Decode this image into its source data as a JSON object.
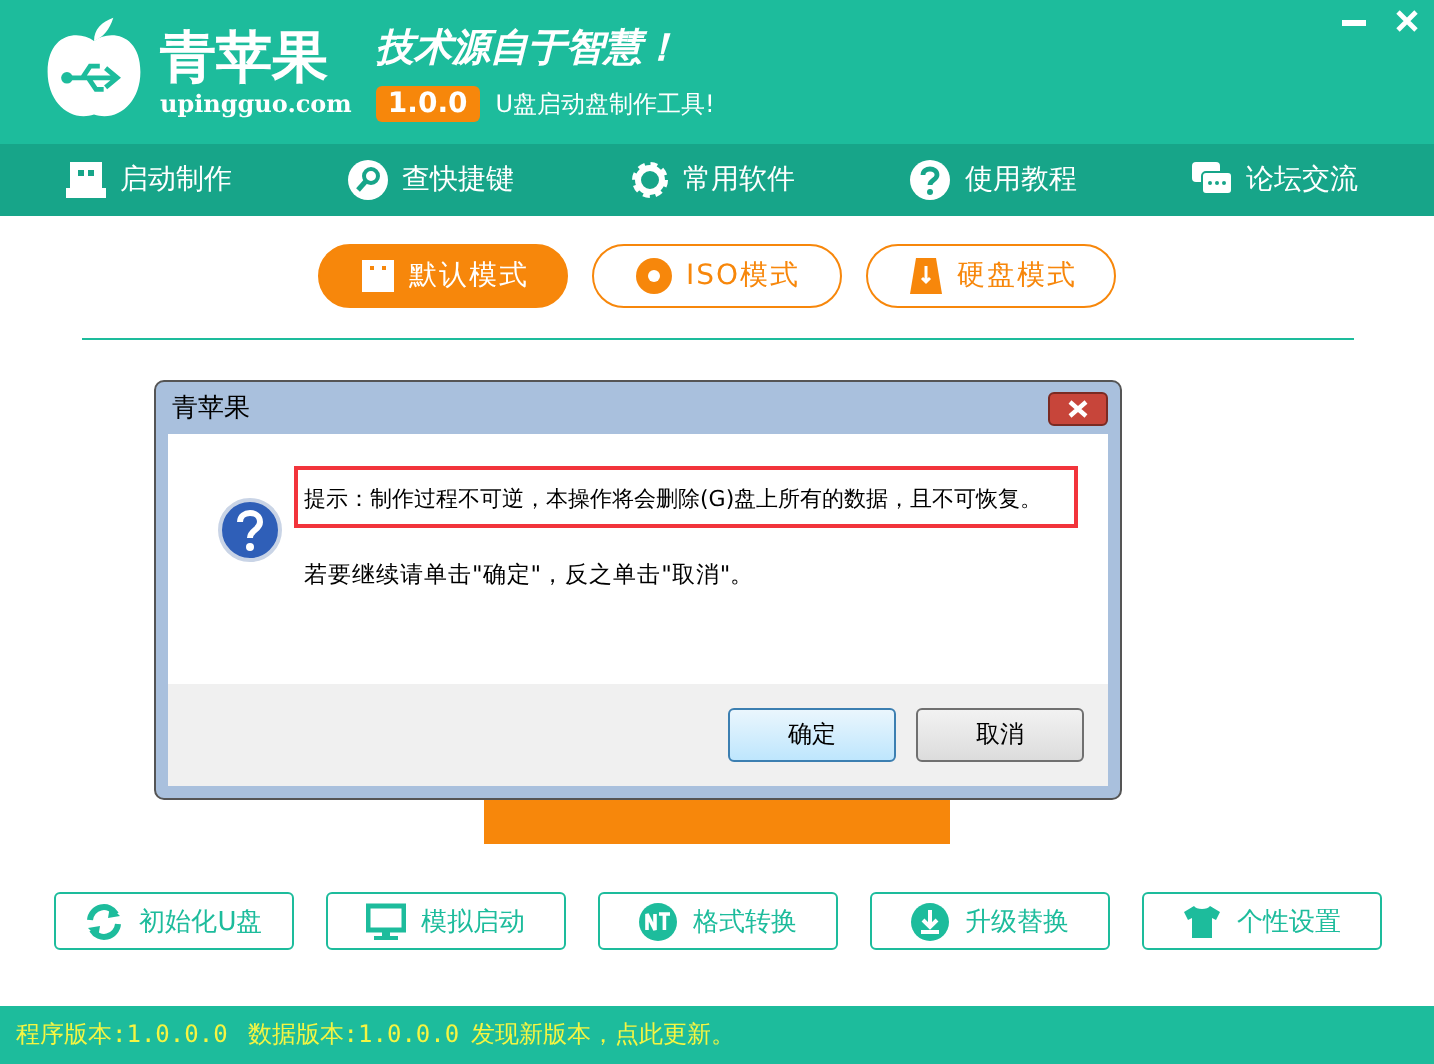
{
  "header": {
    "logo_text": "青苹果",
    "domain": "upingguo.com",
    "slogan": "技术源自于智慧！",
    "version": "1.0.0",
    "tagline": "U盘启动盘制作工具!"
  },
  "nav": [
    {
      "label": "启动制作"
    },
    {
      "label": "查快捷键"
    },
    {
      "label": "常用软件"
    },
    {
      "label": "使用教程"
    },
    {
      "label": "论坛交流"
    }
  ],
  "modes": [
    {
      "label": "默认模式",
      "selected": true
    },
    {
      "label": "ISO模式",
      "selected": false
    },
    {
      "label": "硬盘模式",
      "selected": false
    }
  ],
  "tools": [
    {
      "label": "初始化U盘"
    },
    {
      "label": "模拟启动"
    },
    {
      "label": "格式转换"
    },
    {
      "label": "升级替换"
    },
    {
      "label": "个性设置"
    }
  ],
  "dialog": {
    "title": "青苹果",
    "warning": "提示：制作过程不可逆，本操作将会删除(G)盘上所有的数据，且不可恢复。",
    "message": "若要继续请单击\"确定\"，反之单击\"取消\"。",
    "buttons": [
      {
        "label": "确定",
        "default": true
      },
      {
        "label": "取消",
        "default": false
      }
    ]
  },
  "status_bar": {
    "program_version": "程序版本:1.0.0.0",
    "data_version": "数据版本:1.0.0.0",
    "update_link": "发现新版本，点此更新。"
  }
}
